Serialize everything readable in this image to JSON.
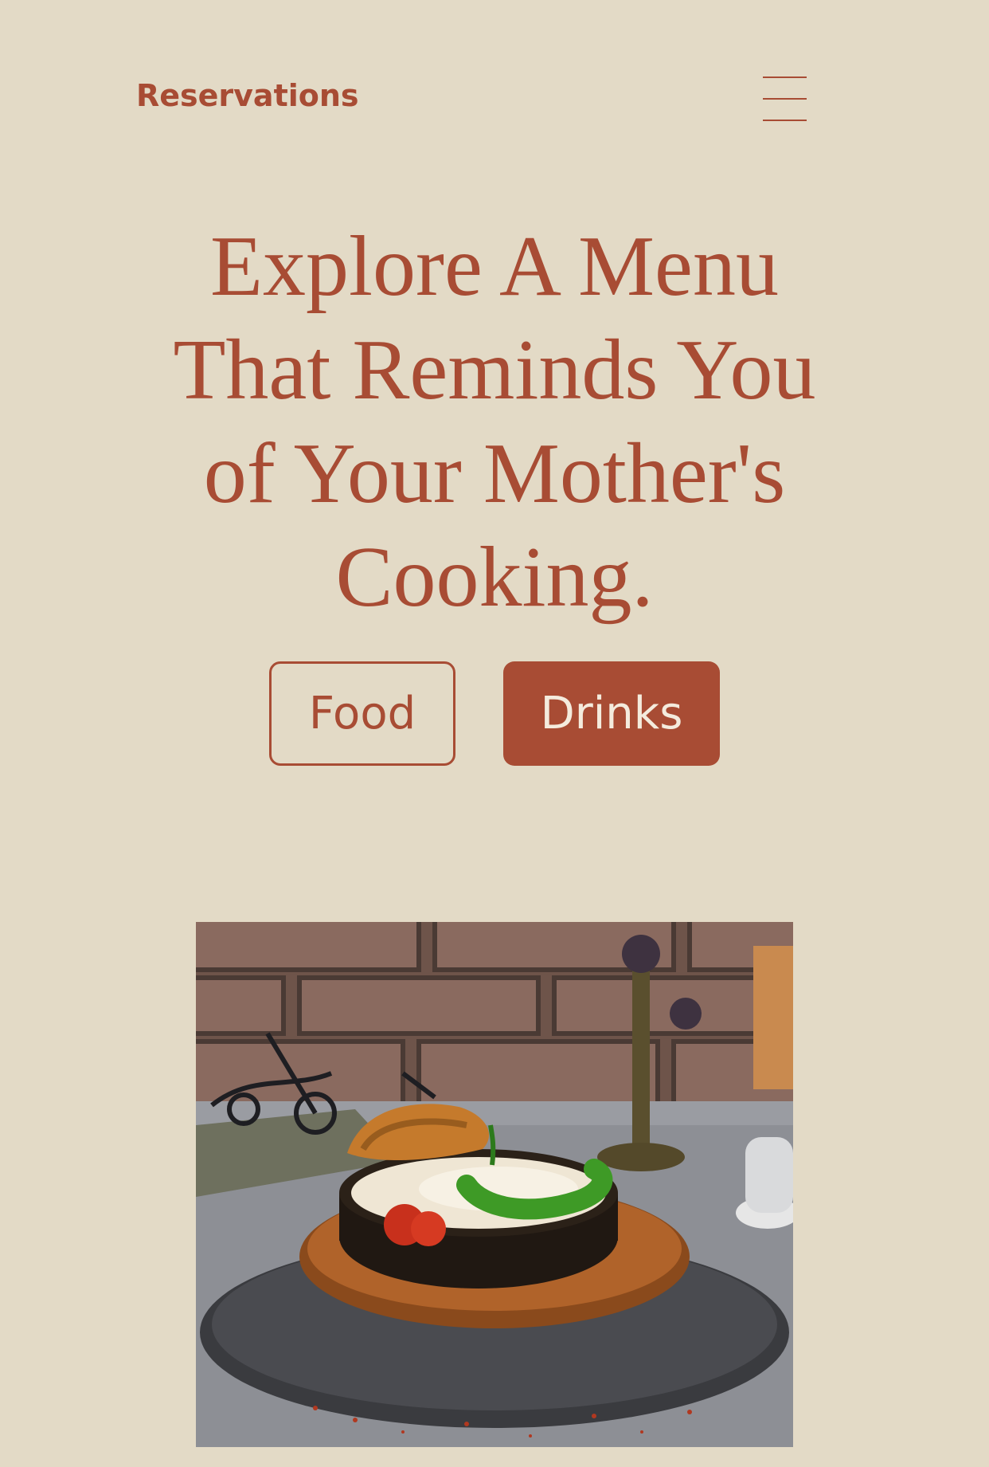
{
  "header": {
    "reservations_label": "Reservations",
    "menu_icon": "hamburger-menu-icon"
  },
  "hero": {
    "title": "Explore A Menu That Reminds You of Your Mother's Cooking."
  },
  "menu_toggle": {
    "food_label": "Food",
    "drinks_label": "Drinks",
    "active": "Drinks"
  },
  "colors": {
    "background": "#e3dac6",
    "accent": "#a84c34",
    "button_text_active": "#f4ebdd"
  }
}
